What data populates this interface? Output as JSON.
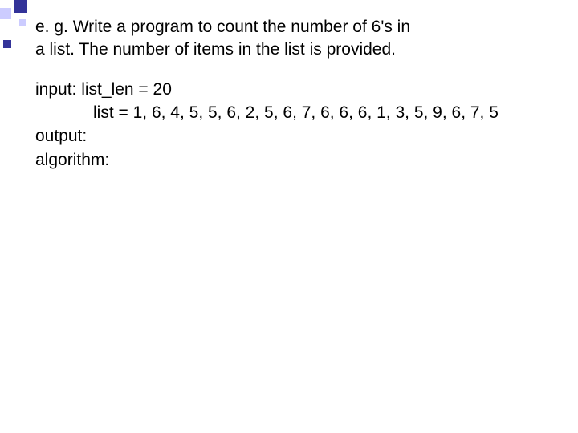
{
  "prompt": {
    "line1": "e. g. Write a program to count the number of 6's in",
    "line2": "a list. The number of items in the list is provided."
  },
  "io": {
    "input_label": "input:",
    "list_len": "list_len = 20",
    "list_vals": "list = 1, 6, 4, 5, 5, 6, 2, 5, 6, 7, 6, 6, 6, 1, 3, 5, 9, 6, 7, 5",
    "output_label": "output:",
    "algorithm_label": "algorithm:"
  }
}
